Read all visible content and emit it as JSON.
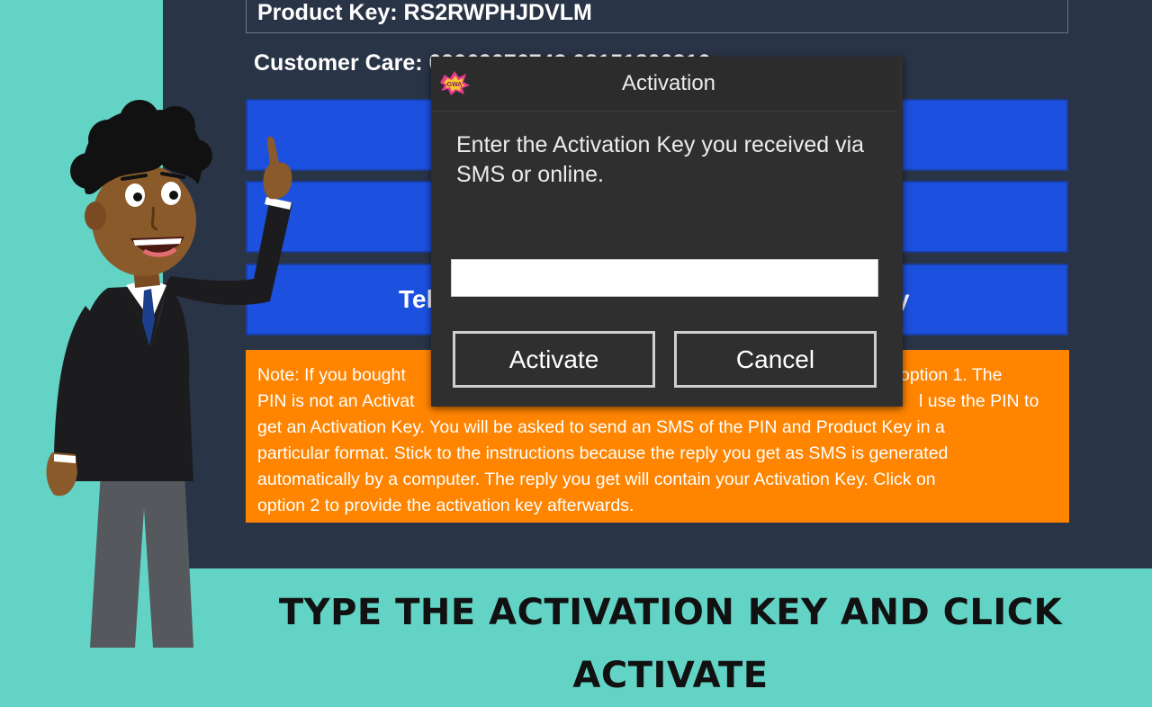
{
  "app": {
    "product_key": "Product Key: RS2RWPHJDVLM",
    "customer_care": "Customer Care: 09069076743 08151800316",
    "option3_left": "Tel",
    "option3_right": "y",
    "note": "Note: If you bought option 1. The PIN is not an Activat use the PIN to get an Activation Key.  You will be asked to send an SMS of the PIN and Product Key in a particular format. Stick to the instructions because the reply you get as SMS is generated automatically by a computer. The reply you get will contain your Activation Key. Click on option 2 to provide the activation key afterwards.",
    "note_lines": [
      "Note: If you bought",
      "PIN is not an Activat",
      "get an Activation Key.  You will be asked to send an SMS of the PIN and Product Key in a",
      "particular format. Stick to the instructions because the reply you get as SMS is generated",
      "automatically by a computer. The reply you get will contain your Activation Key. Click on",
      "option 2 to provide the activation key afterwards."
    ],
    "note_line1_right": "option 1. The",
    "note_line2_right": "l use the PIN to"
  },
  "dialog": {
    "title": "Activation",
    "logo_icon": "app-logo-icon",
    "message": "Enter the Activation Key you received via SMS or online.",
    "input_value": "",
    "activate_label": "Activate",
    "cancel_label": "Cancel"
  },
  "caption": "TYPE THE ACTIVATION KEY AND CLICK ACTIVATE",
  "colors": {
    "background": "#62d3c4",
    "app_bg": "#2a3447",
    "option_button": "#1c50de",
    "note_bg": "#ff8400",
    "dialog_bg": "#2f2f2f"
  }
}
